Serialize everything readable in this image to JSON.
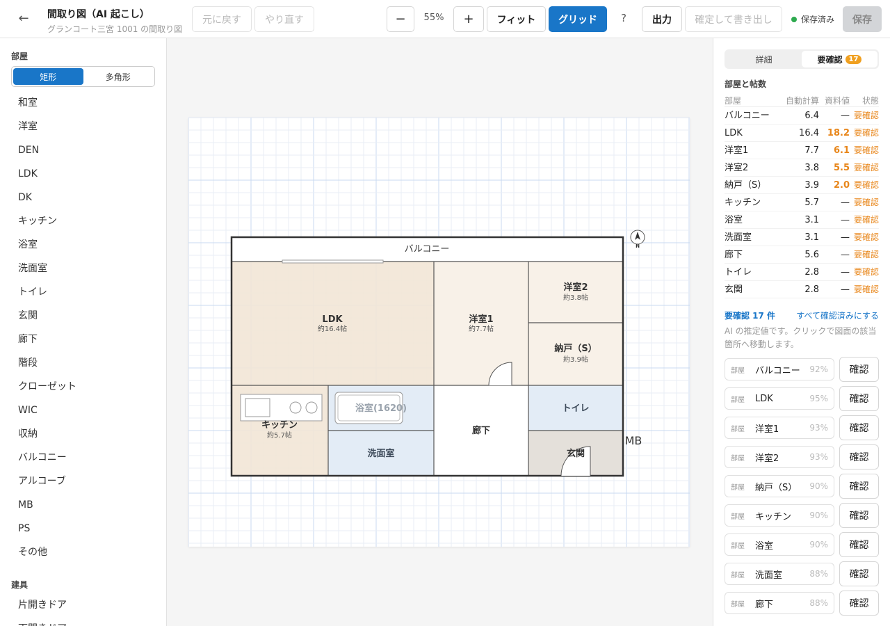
{
  "header": {
    "title": "間取り図（AI 起こし）",
    "subtitle": "グランコート三宮 1001 の間取り図",
    "undo": "元に戻す",
    "redo": "やり直す",
    "zoom_out": "−",
    "zoom": "55%",
    "zoom_in": "+",
    "fit": "フィット",
    "grid": "グリッド",
    "help": "?",
    "export": "出力",
    "confirm_export": "確定して書き出し",
    "saved": "保存済み",
    "save": "保存"
  },
  "left": {
    "rooms_label": "部屋",
    "mode_rect": "矩形",
    "mode_poly": "多角形",
    "rooms": [
      "和室",
      "洋室",
      "DEN",
      "LDK",
      "DK",
      "キッチン",
      "浴室",
      "洗面室",
      "トイレ",
      "玄関",
      "廊下",
      "階段",
      "クローゼット",
      "WIC",
      "収納",
      "バルコニー",
      "アルコーブ",
      "MB",
      "PS",
      "その他"
    ],
    "fixtures_label": "建具",
    "fixtures": [
      "片開きドア",
      "両開きドア"
    ]
  },
  "plan": {
    "balcony": "バルコニー",
    "ldk": "LDK",
    "ldk_size": "約16.4帖",
    "r1": "洋室1",
    "r1_size": "約7.7帖",
    "r2": "洋室2",
    "r2_size": "約3.8帖",
    "storage": "納戸（S）",
    "storage_size": "約3.9帖",
    "kitchen": "キッチン",
    "kitchen_size": "約5.7帖",
    "bath": "浴室(1620)",
    "wash": "洗面室",
    "hall": "廊下",
    "toilet": "トイレ",
    "entrance": "玄関",
    "mb": "MB",
    "north": "N"
  },
  "right": {
    "tab_detail": "詳細",
    "tab_review": "要確認",
    "tab_review_count": "17",
    "table_title": "部屋と帖数",
    "headers": [
      "部屋",
      "自動計算",
      "資料値",
      "状態"
    ],
    "rows": [
      {
        "name": "バルコニー",
        "auto": "6.4",
        "doc": "—",
        "status": "要確認"
      },
      {
        "name": "LDK",
        "auto": "16.4",
        "doc": "18.2",
        "status": "要確認"
      },
      {
        "name": "洋室1",
        "auto": "7.7",
        "doc": "6.1",
        "status": "要確認"
      },
      {
        "name": "洋室2",
        "auto": "3.8",
        "doc": "5.5",
        "status": "要確認"
      },
      {
        "name": "納戸（S）",
        "auto": "3.9",
        "doc": "2.0",
        "status": "要確認"
      },
      {
        "name": "キッチン",
        "auto": "5.7",
        "doc": "—",
        "status": "要確認"
      },
      {
        "name": "浴室",
        "auto": "3.1",
        "doc": "—",
        "status": "要確認"
      },
      {
        "name": "洗面室",
        "auto": "3.1",
        "doc": "—",
        "status": "要確認"
      },
      {
        "name": "廊下",
        "auto": "5.6",
        "doc": "—",
        "status": "要確認"
      },
      {
        "name": "トイレ",
        "auto": "2.8",
        "doc": "—",
        "status": "要確認"
      },
      {
        "name": "玄関",
        "auto": "2.8",
        "doc": "—",
        "status": "要確認"
      }
    ],
    "review_count_label": "要確認 17 件",
    "mark_all": "すべて確認済みにする",
    "note": "AI の推定値です。クリックで図面の該当箇所へ移動します。",
    "items": [
      {
        "kind": "部屋",
        "name": "バルコニー",
        "pct": "92%",
        "btn": "確認"
      },
      {
        "kind": "部屋",
        "name": "LDK",
        "pct": "95%",
        "btn": "確認"
      },
      {
        "kind": "部屋",
        "name": "洋室1",
        "pct": "93%",
        "btn": "確認"
      },
      {
        "kind": "部屋",
        "name": "洋室2",
        "pct": "93%",
        "btn": "確認"
      },
      {
        "kind": "部屋",
        "name": "納戸（S）",
        "pct": "90%",
        "btn": "確認"
      },
      {
        "kind": "部屋",
        "name": "キッチン",
        "pct": "90%",
        "btn": "確認"
      },
      {
        "kind": "部屋",
        "name": "浴室",
        "pct": "90%",
        "btn": "確認"
      },
      {
        "kind": "部屋",
        "name": "洗面室",
        "pct": "88%",
        "btn": "確認"
      },
      {
        "kind": "部屋",
        "name": "廊下",
        "pct": "88%",
        "btn": "確認"
      }
    ]
  }
}
